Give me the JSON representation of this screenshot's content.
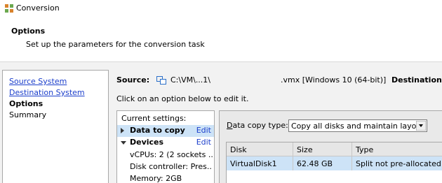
{
  "window": {
    "title": "Conversion",
    "icon": "converter-app-icon"
  },
  "header": {
    "title": "Options",
    "subtitle": "Set up the parameters for the conversion task"
  },
  "nav": {
    "items": [
      {
        "label": "Source System",
        "state": "link"
      },
      {
        "label": "Destination System",
        "state": "link"
      },
      {
        "label": "Options",
        "state": "current"
      },
      {
        "label": "Summary",
        "state": "plain"
      }
    ]
  },
  "source": {
    "label": "Source:",
    "icon": "vm-icon",
    "path": "C:\\VM\\...1\\",
    "vmx": ".vmx [Windows 10 (64-bit)]",
    "destination_label": "Destination:"
  },
  "hint": "Click on an option below to edit it.",
  "settings": {
    "header": "Current settings:",
    "items": [
      {
        "label": "Data to copy",
        "edit": "Edit",
        "expanded": false,
        "selected": true
      },
      {
        "label": "Devices",
        "edit": "Edit",
        "expanded": true,
        "selected": false
      }
    ],
    "device_details": [
      "vCPUs: 2 (2 sockets ...",
      "Disk controller: Pres...",
      "Memory: 2GB"
    ]
  },
  "data_copy": {
    "label": "Data copy type:",
    "value": "Copy all disks and maintain layout"
  },
  "disk_table": {
    "columns": [
      "Disk",
      "Size",
      "Type"
    ],
    "rows": [
      [
        "VirtualDisk1",
        "62.48 GB",
        "Split not pre-allocated"
      ]
    ]
  },
  "colors": {
    "link": "#1b3ecb",
    "selection": "#cde3f7",
    "panel_bg": "#f2f2f2"
  }
}
